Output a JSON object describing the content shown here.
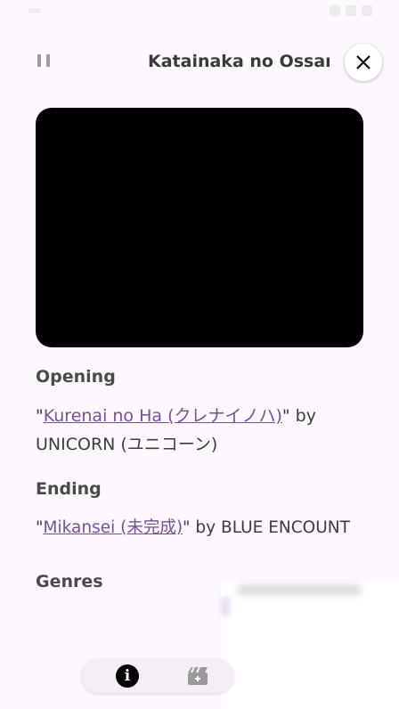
{
  "header": {
    "title": "Katainaka no Ossan Kensei ni Naru"
  },
  "icons": {
    "pause": "pause-icon",
    "close": "close-icon",
    "info": "info-icon",
    "clapper": "clapperboard-icon"
  },
  "opening": {
    "heading": "Opening",
    "quote_open": "\"",
    "song_link": "Kurenai no Ha (クレナイノハ)",
    "quote_close_by": "\" by",
    "artist": "UNICORN (ユニコーン)"
  },
  "ending": {
    "heading": "Ending",
    "quote_open": "\"",
    "song_link": "Mikansei (未完成)",
    "quote_close_by": "\" by BLUE ENCOUNT"
  },
  "genres": {
    "heading": "Genres"
  },
  "bottom_nav": {
    "info_glyph": "i"
  },
  "colors": {
    "background": "#fcf8fd",
    "link": "#7a4f9a",
    "video": "#000000"
  }
}
